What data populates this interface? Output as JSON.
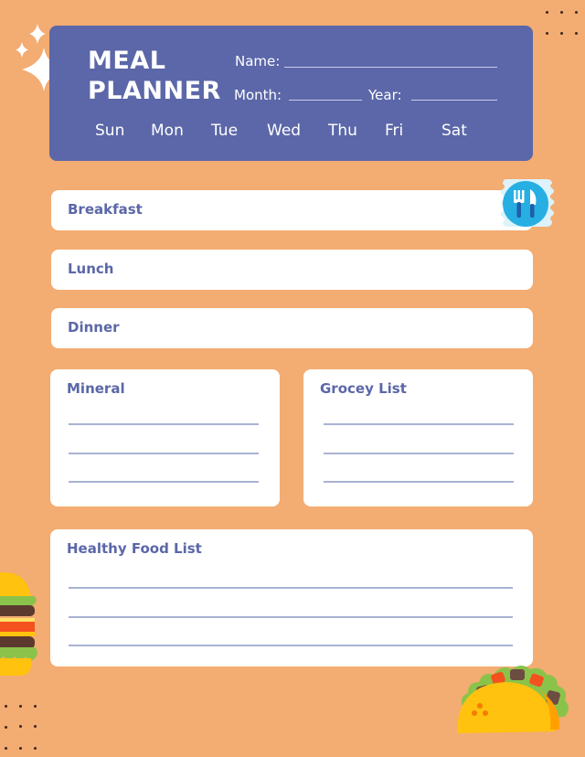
{
  "header": {
    "title_line1": "MEAL",
    "title_line2": "PLANNER",
    "name_label": "Name:",
    "name_value": "",
    "month_label": "Month:",
    "month_value": "",
    "year_label": "Year:",
    "year_value": ""
  },
  "days": [
    "Sun",
    "Mon",
    "Tue",
    "Wed",
    "Thu",
    "Fri",
    "Sat"
  ],
  "meals": [
    {
      "label": "Breakfast"
    },
    {
      "label": "Lunch"
    },
    {
      "label": "Dinner"
    }
  ],
  "cards": {
    "mineral": {
      "title": "Mineral",
      "lines": [
        "",
        "",
        ""
      ]
    },
    "grocery": {
      "title": "Grocey List",
      "lines": [
        "",
        "",
        ""
      ]
    },
    "healthy": {
      "title": "Healthy Food List",
      "lines": [
        "",
        "",
        ""
      ]
    }
  },
  "icons": {
    "sparkles": "sparkles-icon",
    "cutlery": "fork-knife-icon",
    "burger": "burger-illustration",
    "taco": "taco-illustration"
  },
  "colors": {
    "background": "#F3AC72",
    "header": "#5B67A8",
    "label": "#5B67A8",
    "rule": "#A9B2D2"
  }
}
